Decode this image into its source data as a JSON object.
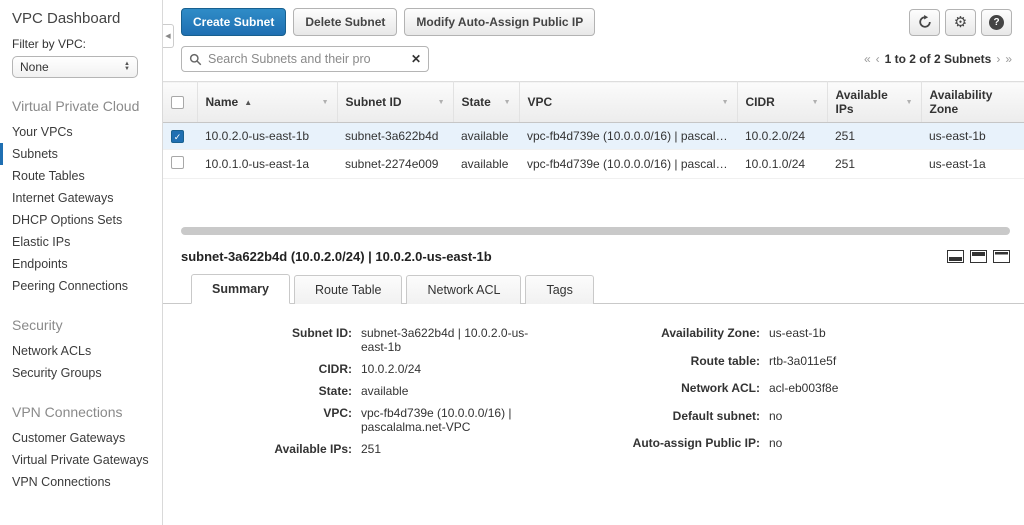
{
  "colors": {
    "primary": "#1f6fb2",
    "primary-light": "#2f8cc7",
    "link": "#3b7bbf",
    "state-green": "#2d862d"
  },
  "sidebar": {
    "title": "VPC Dashboard",
    "filter_label": "Filter by VPC:",
    "filter_value": "None",
    "selected_item": "Subnets",
    "section1_title": "Virtual Private Cloud",
    "section1_items": [
      "Your VPCs",
      "Subnets",
      "Route Tables",
      "Internet Gateways",
      "DHCP Options Sets",
      "Elastic IPs",
      "Endpoints",
      "Peering Connections"
    ],
    "section2_title": "Security",
    "section2_items": [
      "Network ACLs",
      "Security Groups"
    ],
    "section3_title": "VPN Connections",
    "section3_items": [
      "Customer Gateways",
      "Virtual Private Gateways",
      "VPN Connections"
    ]
  },
  "toolbar": {
    "create_label": "Create Subnet",
    "delete_label": "Delete Subnet",
    "modify_label": "Modify Auto-Assign Public IP"
  },
  "search": {
    "placeholder": "Search Subnets and their pro"
  },
  "pagination": {
    "first": "«",
    "prev": "‹",
    "label": "1 to 2 of 2 Subnets",
    "next": "›",
    "last": "»"
  },
  "table": {
    "headers": [
      "Name",
      "Subnet ID",
      "State",
      "VPC",
      "CIDR",
      "Available IPs",
      "Availability Zone"
    ],
    "rows": [
      {
        "name": "10.0.2.0-us-east-1b",
        "subnet_id": "subnet-3a622b4d",
        "state": "available",
        "vpc": "vpc-fb4d739e (10.0.0.0/16) | pascalal...",
        "cidr": "10.0.2.0/24",
        "available_ips": "251",
        "az": "us-east-1b",
        "selected": true
      },
      {
        "name": "10.0.1.0-us-east-1a",
        "subnet_id": "subnet-2274e009",
        "state": "available",
        "vpc": "vpc-fb4d739e (10.0.0.0/16) | pascalal...",
        "cidr": "10.0.1.0/24",
        "available_ips": "251",
        "az": "us-east-1a",
        "selected": false
      }
    ]
  },
  "detail": {
    "title": "subnet-3a622b4d (10.0.2.0/24) | 10.0.2.0-us-east-1b",
    "tabs": [
      "Summary",
      "Route Table",
      "Network ACL",
      "Tags"
    ],
    "active_tab": "Summary",
    "summary_left": [
      {
        "label": "Subnet ID:",
        "value": "subnet-3a622b4d | 10.0.2.0-us-east-1b"
      },
      {
        "label": "CIDR:",
        "value": "10.0.2.0/24"
      },
      {
        "label": "State:",
        "value": "available"
      },
      {
        "label": "VPC:",
        "value": "vpc-fb4d739e (10.0.0.0/16) | pascalalma.net-VPC"
      },
      {
        "label": "Available IPs:",
        "value": "251"
      }
    ],
    "summary_right": [
      {
        "label": "Availability Zone:",
        "value": "us-east-1b"
      },
      {
        "label": "Route table:",
        "value": "rtb-3a011e5f"
      },
      {
        "label": "Network ACL:",
        "value": "acl-eb003f8e"
      },
      {
        "label": "Default subnet:",
        "value": "no"
      },
      {
        "label": "Auto-assign Public IP:",
        "value": "no"
      }
    ]
  }
}
